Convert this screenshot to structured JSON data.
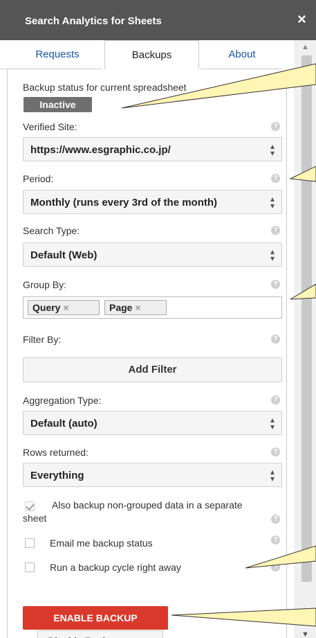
{
  "sidebar": {
    "title": "Search Analytics for Sheets",
    "close_glyph": "×"
  },
  "tabs": {
    "requests": "Requests",
    "backups": "Backups",
    "about": "About"
  },
  "backup_status": {
    "label": "Backup status for current spreadsheet",
    "badge": "Inactive"
  },
  "verified_site": {
    "label": "Verified Site:",
    "value": "https://www.esgraphic.co.jp/"
  },
  "period": {
    "label": "Period:",
    "value": "Monthly (runs every 3rd of the month)"
  },
  "search_type": {
    "label": "Search Type:",
    "value": "Default (Web)"
  },
  "group_by": {
    "label": "Group By:",
    "tags": [
      "Query",
      "Page"
    ]
  },
  "filter_by": {
    "label": "Filter By:",
    "add_filter": "Add Filter"
  },
  "aggregation": {
    "label": "Aggregation Type:",
    "value": "Default (auto)"
  },
  "rows_returned": {
    "label": "Rows returned:",
    "value": "Everything"
  },
  "options": {
    "non_grouped": "Also backup non-grouped data in a separate sheet",
    "email": "Email me backup status",
    "run_now": "Run a backup cycle right away"
  },
  "buttons": {
    "enable": "ENABLE BACKUP",
    "disable": "Disable Backup"
  },
  "colors": {
    "header_bg": "#555555",
    "accent_red": "#d93a2b",
    "link_blue": "#1a55a8",
    "callout_fill": "#fff5b4"
  },
  "icons": {
    "help": "help-circle-icon",
    "select_arrow": "updown-arrows-icon",
    "tag_remove": "close-icon",
    "check": "check-icon"
  }
}
